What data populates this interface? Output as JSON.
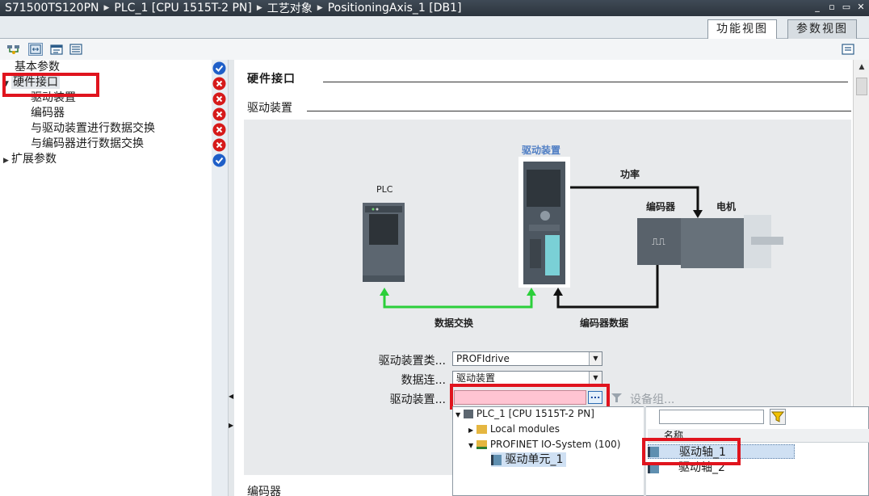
{
  "titlebar": {
    "crumbs": [
      "S71500TS120PN",
      "PLC_1 [CPU 1515T-2 PN]",
      "工艺对象",
      "PositioningAxis_1 [DB1]"
    ]
  },
  "view_tabs": {
    "function_view": "功能视图",
    "parameter_view": "参数视图"
  },
  "nav": {
    "items": [
      {
        "label": "基本参数",
        "status": "ok"
      },
      {
        "label": "硬件接口",
        "status": "error"
      },
      {
        "label": "驱动装置",
        "status": "error"
      },
      {
        "label": "编码器",
        "status": "error"
      },
      {
        "label": "与驱动装置进行数据交换",
        "status": "error"
      },
      {
        "label": "与编码器进行数据交换",
        "status": "error"
      },
      {
        "label": "扩展参数",
        "status": "ok"
      }
    ]
  },
  "main": {
    "section_title": "硬件接口",
    "subsection_title": "驱动装置",
    "next_section": "编码器"
  },
  "diagram": {
    "plc_label": "PLC",
    "drive_label": "驱动装置",
    "power_label": "功率",
    "encoder_label": "编码器",
    "motor_label": "电机",
    "data_exchange_label": "数据交换",
    "encoder_data_label": "编码器数据"
  },
  "form": {
    "drive_type_label": "驱动装置类...",
    "drive_type_value": "PROFIdrive",
    "data_conn_label": "数据连...",
    "data_conn_value": "驱动装置",
    "drive_label": "驱动装置...",
    "drive_value": "",
    "dots": "...",
    "device_config": "设备组..."
  },
  "popup": {
    "tree": [
      {
        "label": "PLC_1 [CPU 1515T-2 PN]"
      },
      {
        "label": "Local modules"
      },
      {
        "label": "PROFINET IO-System (100)"
      },
      {
        "label": "驱动单元_1"
      }
    ],
    "list_header": "名称",
    "list": [
      {
        "label": "驱动轴_1"
      },
      {
        "label": "驱动轴_2"
      }
    ]
  },
  "colors": {
    "accent_red": "#e0141e",
    "ok_blue": "#1f5fc8",
    "error_red": "#d61a1a",
    "arrow_green": "#2bcf3a",
    "highlight_pink": "#ffc4d2"
  }
}
